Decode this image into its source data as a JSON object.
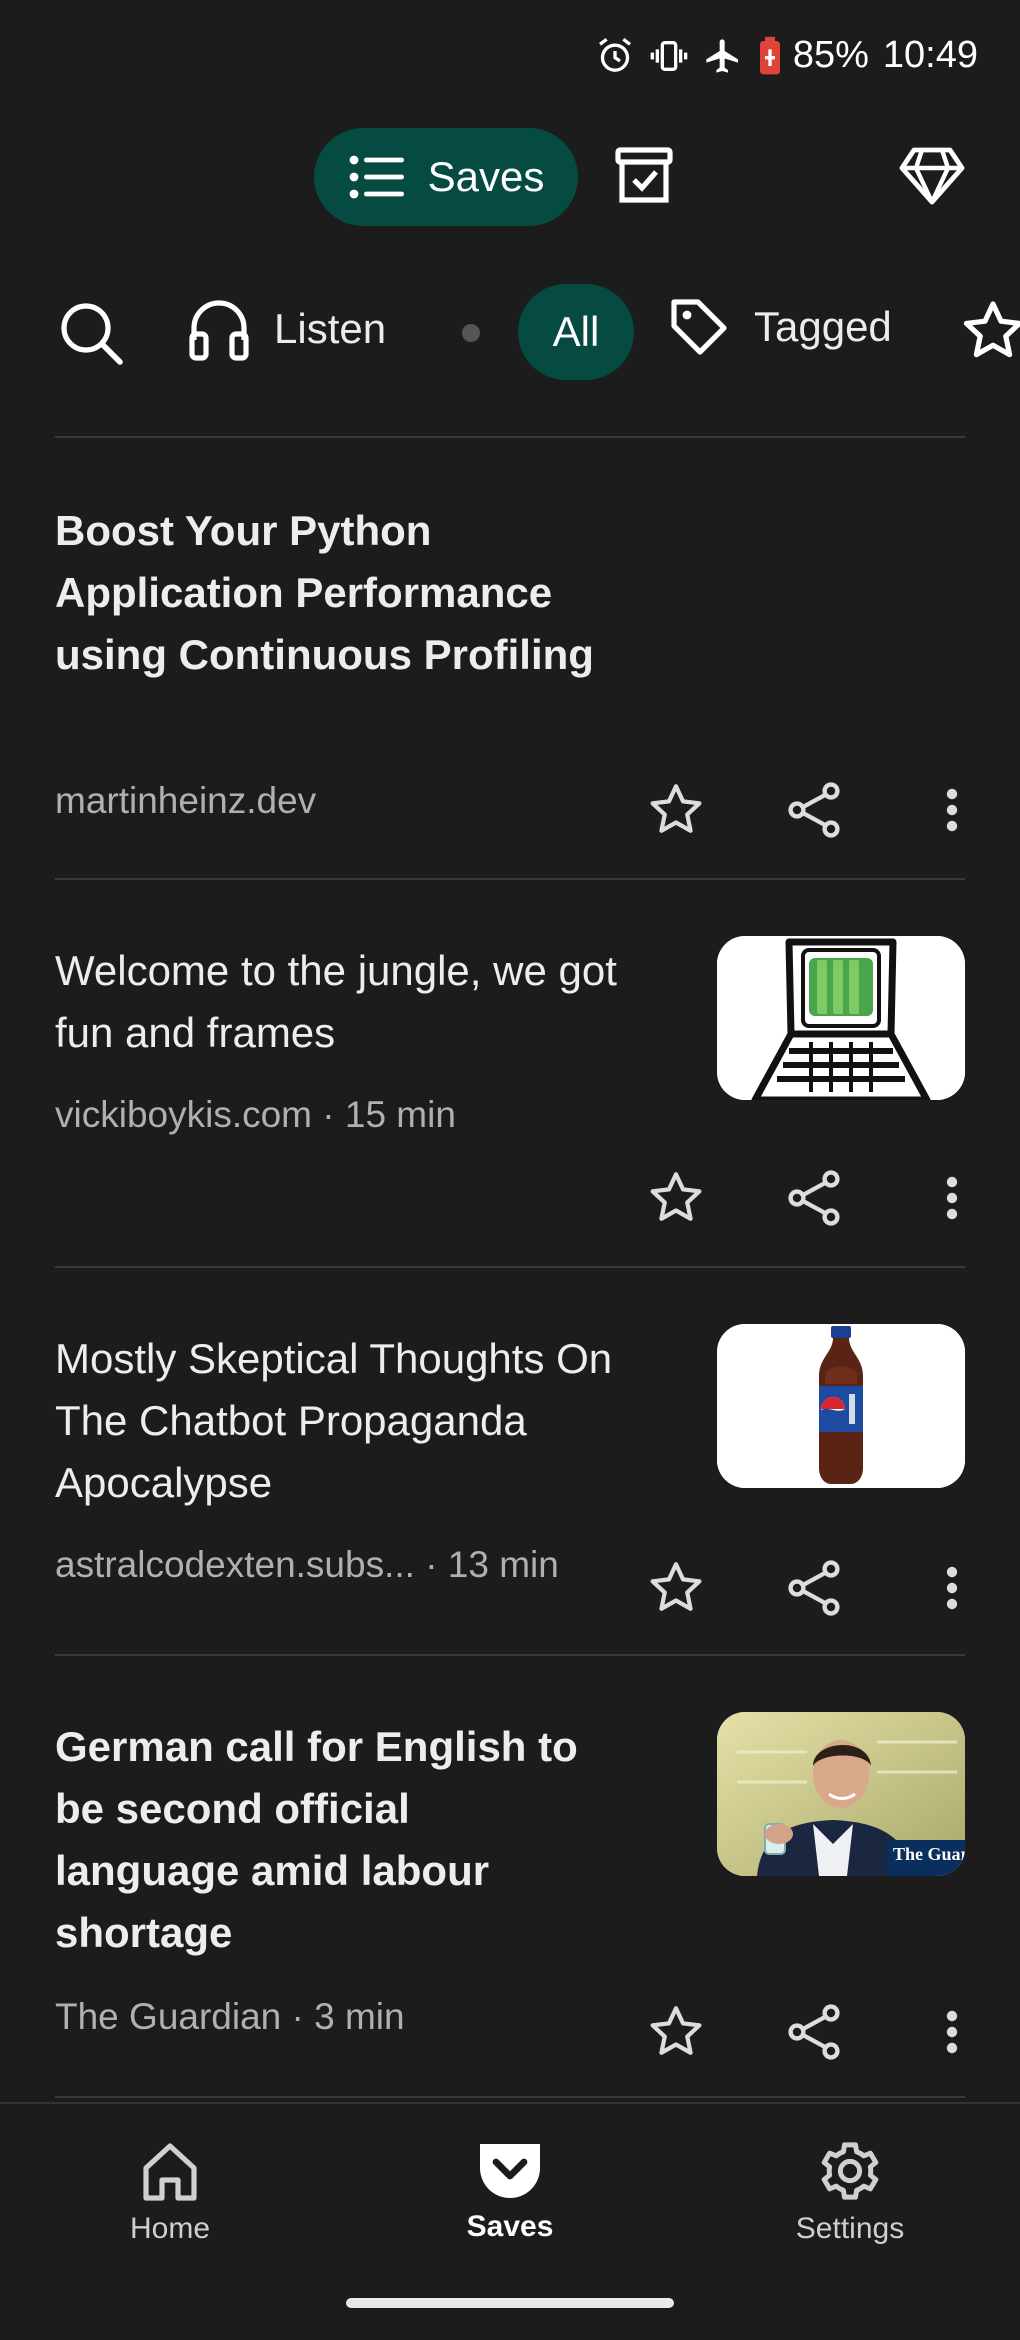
{
  "status": {
    "battery": "85%",
    "time": "10:49"
  },
  "topbar": {
    "saves_label": "Saves"
  },
  "filters": {
    "listen": "Listen",
    "all": "All",
    "tagged": "Tagged"
  },
  "items": [
    {
      "title": "Boost Your Python Application Performance using Continuous Profiling",
      "meta": "martinheinz.dev",
      "bold": true
    },
    {
      "title": "Welcome to the jungle, we got fun and frames",
      "meta": "vickiboykis.com · 15 min",
      "bold": false
    },
    {
      "title": "Mostly Skeptical Thoughts On The Chatbot Propaganda Apocalypse",
      "meta": "astralcodexten.subs... · 13 min",
      "bold": false
    },
    {
      "title": "German call for English to be second official language amid labour shortage",
      "meta": "The Guardian · 3 min",
      "bold": true,
      "thumb_text": "The Guardi"
    }
  ],
  "nav": {
    "home": "Home",
    "saves": "Saves",
    "settings": "Settings"
  },
  "colors": {
    "accent": "#064b42",
    "background": "#1c1c1c"
  }
}
